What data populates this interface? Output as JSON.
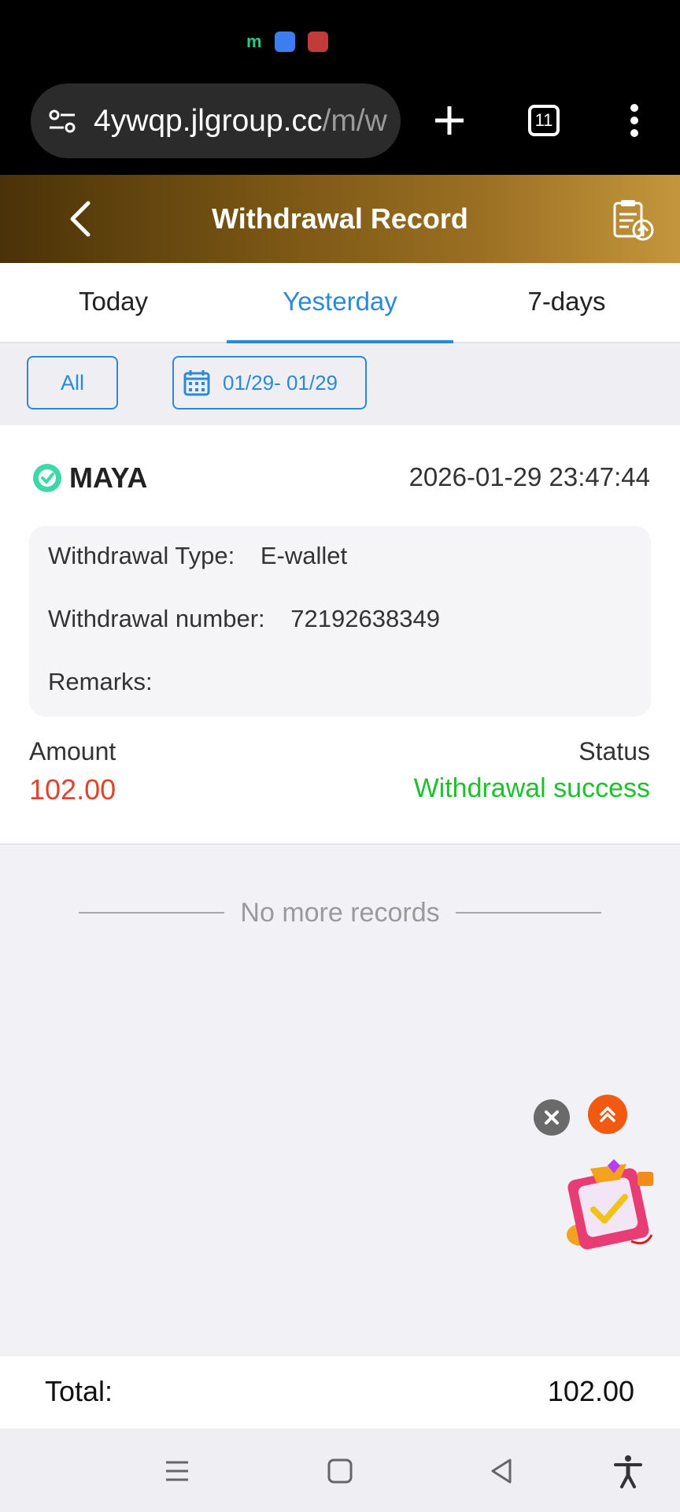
{
  "browser": {
    "url_main": "4ywqp.jlgroup.cc",
    "url_rest": "/m/w",
    "tab_count": "11"
  },
  "header": {
    "title": "Withdrawal Record"
  },
  "tabs": [
    {
      "label": "Today",
      "active": false
    },
    {
      "label": "Yesterday",
      "active": true
    },
    {
      "label": "7-days",
      "active": false
    }
  ],
  "filters": {
    "all_label": "All",
    "date_range": "01/29- 01/29"
  },
  "record": {
    "provider": "MAYA",
    "datetime": "2026-01-29 23:47:44",
    "type_label": "Withdrawal Type",
    "type_value": "E-wallet",
    "number_label": "Withdrawal number",
    "number_value": "72192638349",
    "remarks_label": "Remarks",
    "remarks_value": "",
    "amount_label": "Amount",
    "amount_value": "102.00",
    "status_label": "Status",
    "status_value": "Withdrawal success"
  },
  "no_more": "No more records",
  "total": {
    "label": "Total:",
    "value": "102.00"
  },
  "colors": {
    "accent": "#2b8ad6",
    "amount": "#e0442c",
    "success": "#1fbf2d",
    "header_gradient_start": "#4a3208",
    "header_gradient_end": "#c4963c"
  }
}
